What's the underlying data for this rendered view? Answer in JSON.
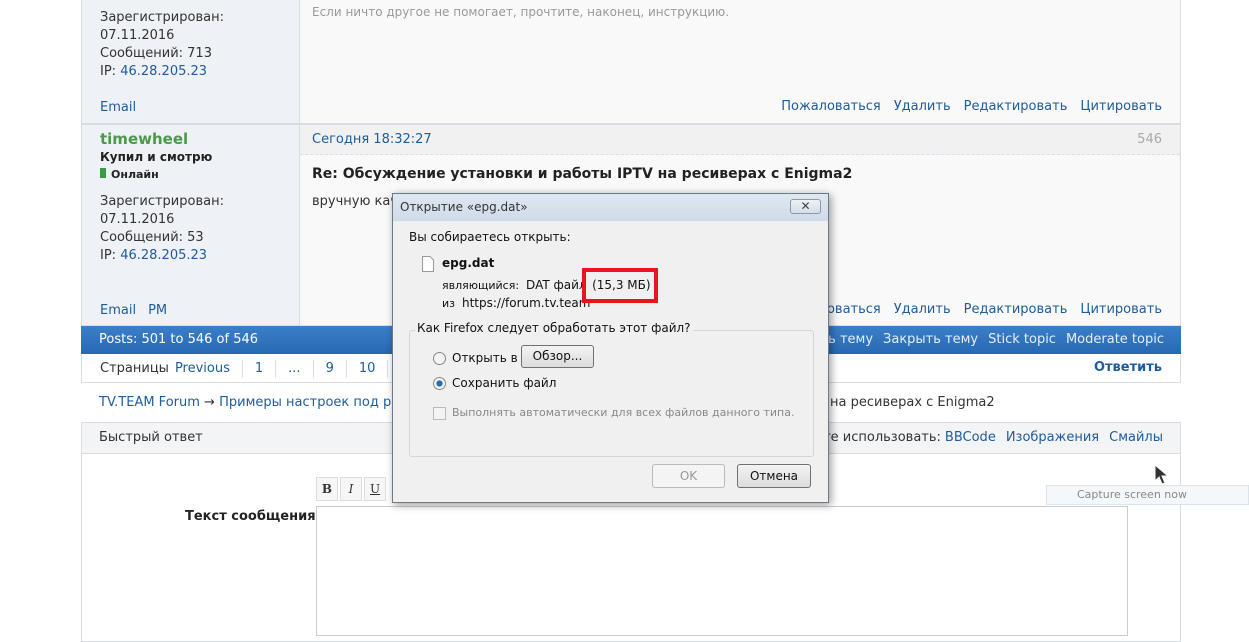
{
  "post1": {
    "registered_label": "Зарегистрирован:",
    "registered": "07.11.2016",
    "messages": "Сообщений: 713",
    "ip_label": "IP:",
    "ip": "46.28.205.23",
    "email": "Email",
    "signature": "Если ничто другое не помогает, прочтите, наконец, инструкцию.",
    "actions": [
      "Пожаловаться",
      "Удалить",
      "Редактировать",
      "Цитировать"
    ]
  },
  "post2": {
    "username": "timewheel",
    "rank": "Купил и смотрю",
    "status": "Онлайн",
    "registered_label": "Зарегистрирован:",
    "registered": "07.11.2016",
    "messages": "Сообщений: 53",
    "ip_label": "IP:",
    "ip": "46.28.205.23",
    "email": "Email",
    "pm": "PM",
    "date": "Сегодня 18:32:27",
    "number": "546",
    "title": "Re: Обсуждение установки и работы IPTV на ресиверах с Enigma2",
    "body": "вручную кач",
    "actions": [
      "…жаловаться",
      "Удалить",
      "Редактировать",
      "Цитировать"
    ]
  },
  "bar": {
    "posts": "Posts: 501 to 546 of 546",
    "actions": [
      "…ить тему",
      "Закрыть тему",
      "Stick topic",
      "Moderate topic"
    ]
  },
  "pagination": {
    "label": "Страницы",
    "items": [
      "Previous",
      "1",
      "...",
      "9",
      "10"
    ],
    "reply": "Ответить"
  },
  "breadcrumb": {
    "root": "TV.TEAM Forum",
    "arrow": "→",
    "section": "Примеры настроек под р…",
    "tail": "на ресиверах с Enigma2"
  },
  "quick_reply": {
    "title": "Быстрый ответ",
    "can_use": "…ете использовать:",
    "links": [
      "BBCode",
      "Изображения",
      "Смайлы"
    ],
    "toolbar": [
      "B",
      "I",
      "U"
    ],
    "text_label": "Текст сообщения"
  },
  "dialog": {
    "title": "Открытие «epg.dat»",
    "intro": "Вы собираетесь открыть:",
    "filename": "epg.dat",
    "type_label": "являющийся:",
    "type": "DAT файл",
    "size": "(15,3 МБ)",
    "from_label": "из",
    "from": "https://forum.tv.team",
    "question": "Как Firefox следует обработать этот файл?",
    "open_with": "Открыть в",
    "browse": "Обзор...",
    "save": "Сохранить файл",
    "save_selected": true,
    "auto": "Выполнять автоматически для всех файлов данного типа.",
    "ok": "OK",
    "cancel": "Отмена",
    "highlight_color": "#e8151f"
  },
  "tooltip": "Capture screen now",
  "colors": {
    "link": "#1e5c9a",
    "bar": "#2f72bf",
    "online": "#3d9a3d",
    "username": "#4a9a4a"
  }
}
